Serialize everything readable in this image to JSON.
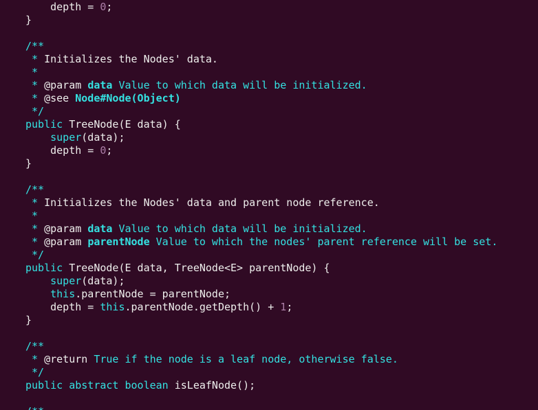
{
  "editor": {
    "lines": [
      {
        "segments": [
          {
            "text": "    depth = ",
            "style": "txt"
          },
          {
            "text": "0",
            "style": "num"
          },
          {
            "text": ";",
            "style": "txt"
          }
        ]
      },
      {
        "segments": [
          {
            "text": "}",
            "style": "txt"
          }
        ]
      },
      {
        "segments": []
      },
      {
        "segments": [
          {
            "text": "/**",
            "style": "cmt"
          }
        ]
      },
      {
        "segments": [
          {
            "text": " * ",
            "style": "cmt"
          },
          {
            "text": "Initializes the Nodes' data.",
            "style": "ctxt"
          }
        ]
      },
      {
        "segments": [
          {
            "text": " *",
            "style": "cmt"
          }
        ]
      },
      {
        "segments": [
          {
            "text": " * ",
            "style": "cmt"
          },
          {
            "text": "@param",
            "style": "tag"
          },
          {
            "text": " ",
            "style": "cmt"
          },
          {
            "text": "data",
            "style": "bold"
          },
          {
            "text": " Value to which data will be initialized.",
            "style": "cmt"
          }
        ]
      },
      {
        "segments": [
          {
            "text": " * ",
            "style": "cmt"
          },
          {
            "text": "@see",
            "style": "tag"
          },
          {
            "text": " ",
            "style": "cmt"
          },
          {
            "text": "Node#Node(Object)",
            "style": "bold"
          }
        ]
      },
      {
        "segments": [
          {
            "text": " */",
            "style": "cmt"
          }
        ]
      },
      {
        "segments": [
          {
            "text": "public",
            "style": "kw"
          },
          {
            "text": " TreeNode(E data) {",
            "style": "txt"
          }
        ]
      },
      {
        "segments": [
          {
            "text": "    ",
            "style": "txt"
          },
          {
            "text": "super",
            "style": "kw"
          },
          {
            "text": "(data);",
            "style": "txt"
          }
        ]
      },
      {
        "segments": [
          {
            "text": "    depth = ",
            "style": "txt"
          },
          {
            "text": "0",
            "style": "num"
          },
          {
            "text": ";",
            "style": "txt"
          }
        ]
      },
      {
        "segments": [
          {
            "text": "}",
            "style": "txt"
          }
        ]
      },
      {
        "segments": []
      },
      {
        "segments": [
          {
            "text": "/**",
            "style": "cmt"
          }
        ]
      },
      {
        "segments": [
          {
            "text": " * ",
            "style": "cmt"
          },
          {
            "text": "Initializes the Nodes' data and parent node reference.",
            "style": "ctxt"
          }
        ]
      },
      {
        "segments": [
          {
            "text": " *",
            "style": "cmt"
          }
        ]
      },
      {
        "segments": [
          {
            "text": " * ",
            "style": "cmt"
          },
          {
            "text": "@param",
            "style": "tag"
          },
          {
            "text": " ",
            "style": "cmt"
          },
          {
            "text": "data",
            "style": "bold"
          },
          {
            "text": " Value to which data will be initialized.",
            "style": "cmt"
          }
        ]
      },
      {
        "segments": [
          {
            "text": " * ",
            "style": "cmt"
          },
          {
            "text": "@param",
            "style": "tag"
          },
          {
            "text": " ",
            "style": "cmt"
          },
          {
            "text": "parentNode",
            "style": "bold"
          },
          {
            "text": " Value to which the nodes' parent reference will be set.",
            "style": "cmt"
          }
        ]
      },
      {
        "segments": [
          {
            "text": " */",
            "style": "cmt"
          }
        ]
      },
      {
        "segments": [
          {
            "text": "public",
            "style": "kw"
          },
          {
            "text": " TreeNode(E data, TreeNode<E> parentNode) {",
            "style": "txt"
          }
        ]
      },
      {
        "segments": [
          {
            "text": "    ",
            "style": "txt"
          },
          {
            "text": "super",
            "style": "kw"
          },
          {
            "text": "(data);",
            "style": "txt"
          }
        ]
      },
      {
        "segments": [
          {
            "text": "    ",
            "style": "txt"
          },
          {
            "text": "this",
            "style": "kw"
          },
          {
            "text": ".parentNode = parentNode;",
            "style": "txt"
          }
        ]
      },
      {
        "segments": [
          {
            "text": "    depth = ",
            "style": "txt"
          },
          {
            "text": "this",
            "style": "kw"
          },
          {
            "text": ".parentNode.getDepth() + ",
            "style": "txt"
          },
          {
            "text": "1",
            "style": "num"
          },
          {
            "text": ";",
            "style": "txt"
          }
        ]
      },
      {
        "segments": [
          {
            "text": "}",
            "style": "txt"
          }
        ]
      },
      {
        "segments": []
      },
      {
        "segments": [
          {
            "text": "/**",
            "style": "cmt"
          }
        ]
      },
      {
        "segments": [
          {
            "text": " * ",
            "style": "cmt"
          },
          {
            "text": "@return",
            "style": "tag"
          },
          {
            "text": " True if the node is a leaf node, otherwise false.",
            "style": "cmt"
          }
        ]
      },
      {
        "segments": [
          {
            "text": " */",
            "style": "cmt"
          }
        ]
      },
      {
        "segments": [
          {
            "text": "public",
            "style": "kw"
          },
          {
            "text": " ",
            "style": "txt"
          },
          {
            "text": "abstract",
            "style": "kw"
          },
          {
            "text": " ",
            "style": "txt"
          },
          {
            "text": "boolean",
            "style": "kw"
          },
          {
            "text": " isLeafNode();",
            "style": "txt"
          }
        ]
      },
      {
        "segments": []
      },
      {
        "segments": [
          {
            "text": "/**",
            "style": "cmt"
          }
        ]
      }
    ]
  }
}
